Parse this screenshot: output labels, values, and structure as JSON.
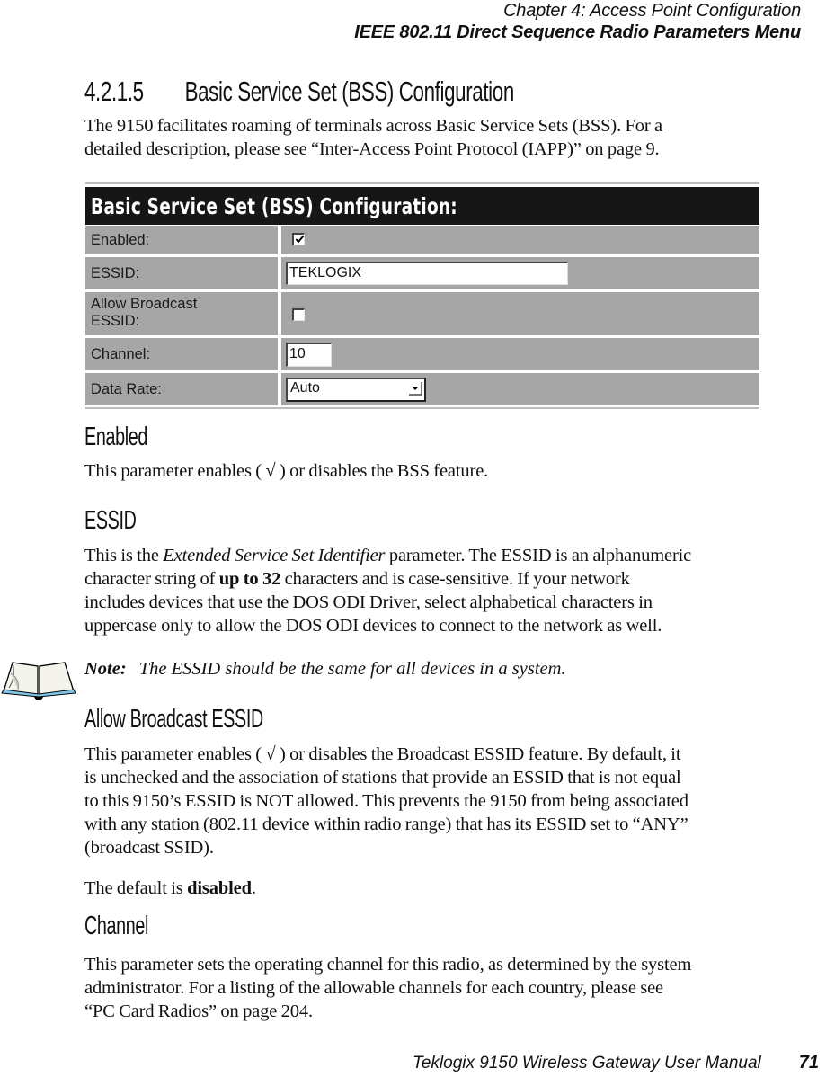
{
  "running_head": {
    "chapter": "Chapter 4:  Access Point Configuration",
    "section": "IEEE 802.11 Direct Sequence Radio Parameters Menu"
  },
  "section": {
    "number": "4.2.1.5",
    "title": "Basic Service Set (BSS) Configuration",
    "intro_line1": "The 9150 facilitates roaming of terminals across Basic Service Sets (BSS). For a",
    "intro_line2": "detailed description, please see “Inter-Access Point Protocol (IAPP)” on page 9."
  },
  "panel": {
    "title": "Basic Service Set (BSS) Configuration:",
    "rows": [
      {
        "label": "Enabled:",
        "type": "checkbox",
        "checked": true
      },
      {
        "label": "ESSID:",
        "type": "text",
        "value": "TEKLOGIX"
      },
      {
        "label_line1": "Allow Broadcast",
        "label_line2": "ESSID:",
        "type": "checkbox",
        "checked": false
      },
      {
        "label": "Channel:",
        "type": "text",
        "value": "10"
      },
      {
        "label": "Data Rate:",
        "type": "select",
        "value": "Auto"
      }
    ]
  },
  "enabled": {
    "heading": "Enabled",
    "text": "This parameter enables ( √ ) or disables the BSS feature."
  },
  "essid": {
    "heading": "ESSID",
    "l1_pre": "This is the ",
    "l1_italic": "Extended Service Set Identifier",
    "l1_post": " parameter. The ESSID is an alphanumeric",
    "l2_pre": "character string of ",
    "l2_bold": "up to 32",
    "l2_post": " characters and is case-sensitive. If your network",
    "l3": "includes devices that use the DOS ODI Driver, select alphabetical characters in",
    "l4": "uppercase only to allow the DOS ODI devices to connect to the network as well."
  },
  "note": {
    "icon": "open-book-icon",
    "label": "Note:",
    "text": "The ESSID should be the same for all devices in a system."
  },
  "broadcast": {
    "heading": "Allow Broadcast ESSID",
    "l1": "This parameter enables ( √ ) or disables the Broadcast ESSID feature. By default, it",
    "l2": "is unchecked and the association of stations that provide an ESSID that is not equal",
    "l3": "to this 9150’s ESSID is NOT allowed. This prevents the 9150 from being associated",
    "l4": "with any station (802.11 device within radio range) that has its ESSID set to “ANY”",
    "l5": "(broadcast SSID).",
    "default_pre": "The default is ",
    "default_bold": "disabled",
    "default_post": "."
  },
  "channel": {
    "heading": "Channel",
    "l1": "This parameter sets the operating channel for this radio, as determined by the system",
    "l2": "administrator. For a listing of the allowable channels for each country, please see",
    "l3": "“PC Card Radios” on page 204."
  },
  "footer": {
    "title": "Teklogix 9150 Wireless Gateway User Manual",
    "page_number": "71"
  }
}
